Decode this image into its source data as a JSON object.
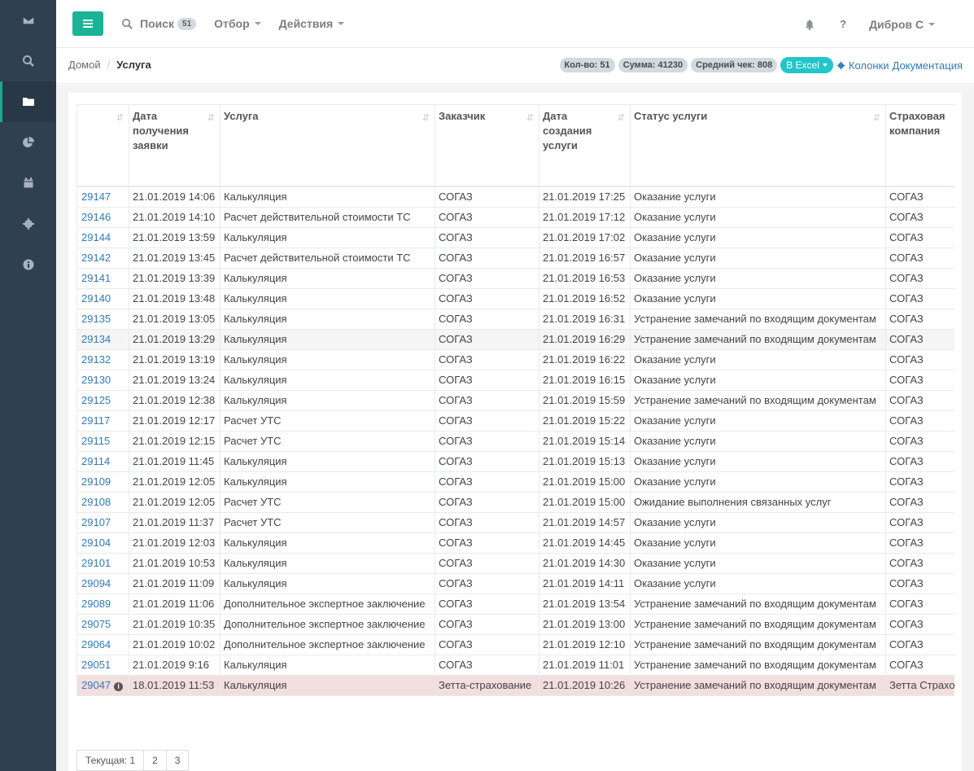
{
  "sidebar": {
    "items": [
      {
        "icon": "envelope-icon"
      },
      {
        "icon": "search-icon"
      },
      {
        "icon": "folder-icon",
        "active": true
      },
      {
        "icon": "pie-chart-icon"
      },
      {
        "icon": "calendar-icon"
      },
      {
        "icon": "gear-icon"
      },
      {
        "icon": "info-icon"
      }
    ]
  },
  "topbar": {
    "search_label": "Поиск",
    "search_count": "51",
    "filter_label": "Отбор",
    "actions_label": "Действия",
    "help_label": "?",
    "user_name": "Дибров С"
  },
  "breadcrumb": {
    "home": "Домой",
    "separator": "/",
    "current": "Услуга"
  },
  "stats": {
    "count": "Кол-во: 51",
    "sum": "Сумма: 41230",
    "avg": "Средний чек: 808",
    "excel": "В Excel",
    "columns": "Колонки",
    "docs": "Документация"
  },
  "table": {
    "headers": [
      "",
      "Дата получения заявки",
      "Услуга",
      "Заказчик",
      "Дата создания услуги",
      "Статус услуги",
      "Страховая компания"
    ],
    "rows": [
      [
        "29147",
        "21.01.2019 14:06",
        "Калькуляция",
        "СОГАЗ",
        "21.01.2019 17:25",
        "Оказание услуги",
        "СОГАЗ"
      ],
      [
        "29146",
        "21.01.2019 14:10",
        "Расчет действительной стоимости ТС",
        "СОГАЗ",
        "21.01.2019 17:12",
        "Оказание услуги",
        "СОГАЗ"
      ],
      [
        "29144",
        "21.01.2019 13:59",
        "Калькуляция",
        "СОГАЗ",
        "21.01.2019 17:02",
        "Оказание услуги",
        "СОГАЗ"
      ],
      [
        "29142",
        "21.01.2019 13:45",
        "Расчет действительной стоимости ТС",
        "СОГАЗ",
        "21.01.2019 16:57",
        "Оказание услуги",
        "СОГАЗ"
      ],
      [
        "29141",
        "21.01.2019 13:39",
        "Калькуляция",
        "СОГАЗ",
        "21.01.2019 16:53",
        "Оказание услуги",
        "СОГАЗ"
      ],
      [
        "29140",
        "21.01.2019 13:48",
        "Калькуляция",
        "СОГАЗ",
        "21.01.2019 16:52",
        "Оказание услуги",
        "СОГАЗ"
      ],
      [
        "29135",
        "21.01.2019 13:05",
        "Калькуляция",
        "СОГАЗ",
        "21.01.2019 16:31",
        "Устранение замечаний по входящим документам",
        "СОГАЗ"
      ],
      [
        "29134",
        "21.01.2019 13:29",
        "Калькуляция",
        "СОГАЗ",
        "21.01.2019 16:29",
        "Устранение замечаний по входящим документам",
        "СОГАЗ"
      ],
      [
        "29132",
        "21.01.2019 13:19",
        "Калькуляция",
        "СОГАЗ",
        "21.01.2019 16:22",
        "Оказание услуги",
        "СОГАЗ"
      ],
      [
        "29130",
        "21.01.2019 13:24",
        "Калькуляция",
        "СОГАЗ",
        "21.01.2019 16:15",
        "Оказание услуги",
        "СОГАЗ"
      ],
      [
        "29125",
        "21.01.2019 12:38",
        "Калькуляция",
        "СОГАЗ",
        "21.01.2019 15:59",
        "Устранение замечаний по входящим документам",
        "СОГАЗ"
      ],
      [
        "29117",
        "21.01.2019 12:17",
        "Расчет УТС",
        "СОГАЗ",
        "21.01.2019 15:22",
        "Оказание услуги",
        "СОГАЗ"
      ],
      [
        "29115",
        "21.01.2019 12:15",
        "Расчет УТС",
        "СОГАЗ",
        "21.01.2019 15:14",
        "Оказание услуги",
        "СОГАЗ"
      ],
      [
        "29114",
        "21.01.2019 11:45",
        "Калькуляция",
        "СОГАЗ",
        "21.01.2019 15:13",
        "Оказание услуги",
        "СОГАЗ"
      ],
      [
        "29109",
        "21.01.2019 12:05",
        "Калькуляция",
        "СОГАЗ",
        "21.01.2019 15:00",
        "Оказание услуги",
        "СОГАЗ"
      ],
      [
        "29108",
        "21.01.2019 12:05",
        "Расчет УТС",
        "СОГАЗ",
        "21.01.2019 15:00",
        "Ожидание выполнения связанных услуг",
        "СОГАЗ"
      ],
      [
        "29107",
        "21.01.2019 11:37",
        "Расчет УТС",
        "СОГАЗ",
        "21.01.2019 14:57",
        "Оказание услуги",
        "СОГАЗ"
      ],
      [
        "29104",
        "21.01.2019 12:03",
        "Калькуляция",
        "СОГАЗ",
        "21.01.2019 14:45",
        "Оказание услуги",
        "СОГАЗ"
      ],
      [
        "29101",
        "21.01.2019 10:53",
        "Калькуляция",
        "СОГАЗ",
        "21.01.2019 14:30",
        "Оказание услуги",
        "СОГАЗ"
      ],
      [
        "29094",
        "21.01.2019 11:09",
        "Калькуляция",
        "СОГАЗ",
        "21.01.2019 14:11",
        "Оказание услуги",
        "СОГАЗ"
      ],
      [
        "29089",
        "21.01.2019 11:06",
        "Дополнительное экспертное заключение",
        "СОГАЗ",
        "21.01.2019 13:54",
        "Устранение замечаний по входящим документам",
        "СОГАЗ"
      ],
      [
        "29075",
        "21.01.2019 10:35",
        "Дополнительное экспертное заключение",
        "СОГАЗ",
        "21.01.2019 13:00",
        "Устранение замечаний по входящим документам",
        "СОГАЗ"
      ],
      [
        "29064",
        "21.01.2019 10:02",
        "Дополнительное экспертное заключение",
        "СОГАЗ",
        "21.01.2019 12:10",
        "Устранение замечаний по входящим документам",
        "СОГАЗ"
      ],
      [
        "29051",
        "21.01.2019 9:16",
        "Калькуляция",
        "СОГАЗ",
        "21.01.2019 11:01",
        "Устранение замечаний по входящим документам",
        "СОГАЗ"
      ],
      [
        "29047",
        "18.01.2019 11:53",
        "Калькуляция",
        "Зетта-страхование",
        "21.01.2019 10:26",
        "Устранение замечаний по входящим документам",
        "Зетта Страхование"
      ]
    ],
    "highlighted_row": 7,
    "error_row": 24
  },
  "pagination": {
    "current": "Текущая: 1",
    "pages": [
      "2",
      "3"
    ]
  }
}
